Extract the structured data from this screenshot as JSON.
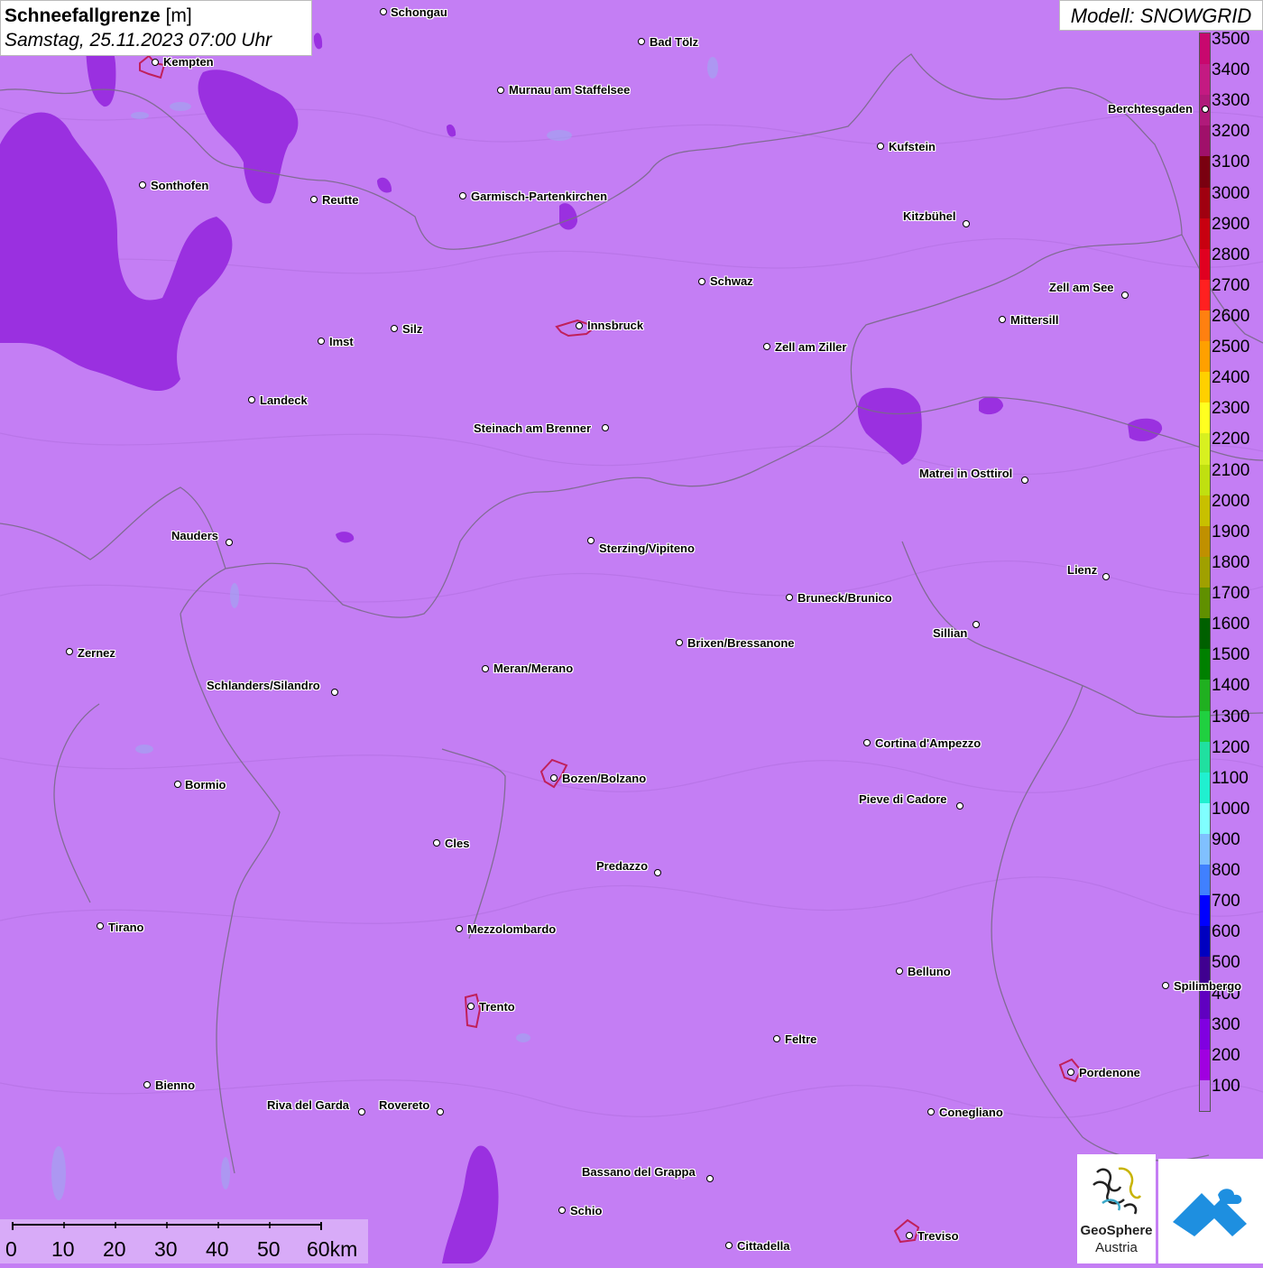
{
  "header": {
    "title_bold": "Schneefallgrenze",
    "title_unit": "[m]",
    "datetime": "Samstag, 25.11.2023 07:00 Uhr"
  },
  "model": {
    "label": "Modell: SNOWGRID"
  },
  "legend": {
    "levels": [
      3500,
      3400,
      3300,
      3200,
      3100,
      3000,
      2900,
      2800,
      2700,
      2600,
      2500,
      2400,
      2300,
      2200,
      2100,
      2000,
      1900,
      1800,
      1700,
      1600,
      1500,
      1400,
      1300,
      1200,
      1100,
      1000,
      900,
      800,
      700,
      600,
      500,
      400,
      300,
      200,
      100
    ],
    "colors": [
      "#c8086e",
      "#c41a82",
      "#b01a7a",
      "#a0106a",
      "#7a0010",
      "#a00010",
      "#c80010",
      "#e00020",
      "#ff2020",
      "#ff8010",
      "#ffa000",
      "#ffd000",
      "#ffff20",
      "#d8f020",
      "#c0e010",
      "#c8c000",
      "#c09000",
      "#a0a000",
      "#609000",
      "#006000",
      "#008000",
      "#20b020",
      "#20d040",
      "#20e0a0",
      "#20f0d0",
      "#80ffff",
      "#80c0ff",
      "#4080ff",
      "#0000ff",
      "#0000c0",
      "#400090",
      "#6000c0",
      "#8000e0",
      "#a000e0",
      "#c070f0"
    ]
  },
  "cities": [
    {
      "name": "Schongau",
      "dot": [
        425,
        13
      ],
      "label": [
        433,
        7
      ],
      "side": "r"
    },
    {
      "name": "Bad Tölz",
      "dot": [
        711,
        46
      ],
      "label": [
        720,
        40
      ],
      "side": "r"
    },
    {
      "name": "Kempten",
      "dot": [
        172,
        69
      ],
      "label": [
        181,
        62
      ],
      "side": "r"
    },
    {
      "name": "Murnau am Staffelsee",
      "dot": [
        555,
        100
      ],
      "label": [
        564,
        93
      ],
      "side": "r"
    },
    {
      "name": "Berchtesgaden",
      "dot": [
        1336,
        121
      ],
      "label": [
        1228,
        114
      ],
      "side": "l"
    },
    {
      "name": "Kufstein",
      "dot": [
        976,
        162
      ],
      "label": [
        985,
        156
      ],
      "side": "r"
    },
    {
      "name": "Sonthofen",
      "dot": [
        158,
        205
      ],
      "label": [
        167,
        199
      ],
      "side": "r"
    },
    {
      "name": "Reutte",
      "dot": [
        348,
        221
      ],
      "label": [
        357,
        215
      ],
      "side": "r"
    },
    {
      "name": "Garmisch-Partenkirchen",
      "dot": [
        513,
        217
      ],
      "label": [
        522,
        211
      ],
      "side": "r"
    },
    {
      "name": "Kitzbühel",
      "dot": [
        1071,
        248
      ],
      "label": [
        1001,
        233
      ],
      "side": "l"
    },
    {
      "name": "Schwaz",
      "dot": [
        778,
        312
      ],
      "label": [
        787,
        305
      ],
      "side": "r"
    },
    {
      "name": "Zell am See",
      "dot": [
        1247,
        327
      ],
      "label": [
        1163,
        312
      ],
      "side": "l"
    },
    {
      "name": "Mittersill",
      "dot": [
        1111,
        354
      ],
      "label": [
        1120,
        348
      ],
      "side": "r"
    },
    {
      "name": "Innsbruck",
      "dot": [
        642,
        361
      ],
      "label": [
        651,
        354
      ],
      "side": "r"
    },
    {
      "name": "Silz",
      "dot": [
        437,
        364
      ],
      "label": [
        446,
        358
      ],
      "side": "r"
    },
    {
      "name": "Imst",
      "dot": [
        356,
        378
      ],
      "label": [
        365,
        372
      ],
      "side": "r"
    },
    {
      "name": "Zell am Ziller",
      "dot": [
        850,
        384
      ],
      "label": [
        859,
        378
      ],
      "side": "r"
    },
    {
      "name": "Landeck",
      "dot": [
        279,
        443
      ],
      "label": [
        288,
        437
      ],
      "side": "r"
    },
    {
      "name": "Steinach am Brenner",
      "dot": [
        671,
        474
      ],
      "label": [
        525,
        468
      ],
      "side": "l"
    },
    {
      "name": "Matrei in Osttirol",
      "dot": [
        1136,
        532
      ],
      "label": [
        1019,
        518
      ],
      "side": "l"
    },
    {
      "name": "Nauders",
      "dot": [
        254,
        601
      ],
      "label": [
        190,
        587
      ],
      "side": "l"
    },
    {
      "name": "Sterzing/Vipiteno",
      "dot": [
        655,
        599
      ],
      "label": [
        664,
        601
      ],
      "side": "r"
    },
    {
      "name": "Lienz",
      "dot": [
        1226,
        639
      ],
      "label": [
        1183,
        625
      ],
      "side": "l"
    },
    {
      "name": "Bruneck/Brunico",
      "dot": [
        875,
        662
      ],
      "label": [
        884,
        656
      ],
      "side": "r"
    },
    {
      "name": "Sillian",
      "dot": [
        1082,
        692
      ],
      "label": [
        1034,
        695
      ],
      "side": "l"
    },
    {
      "name": "Brixen/Bressanone",
      "dot": [
        753,
        712
      ],
      "label": [
        762,
        706
      ],
      "side": "r"
    },
    {
      "name": "Zernez",
      "dot": [
        77,
        722
      ],
      "label": [
        86,
        717
      ],
      "side": "r"
    },
    {
      "name": "Meran/Merano",
      "dot": [
        538,
        741
      ],
      "label": [
        547,
        734
      ],
      "side": "r"
    },
    {
      "name": "Schlanders/Silandro",
      "dot": [
        371,
        767
      ],
      "label": [
        229,
        753
      ],
      "side": "l"
    },
    {
      "name": "Cortina d'Ampezzo",
      "dot": [
        961,
        823
      ],
      "label": [
        970,
        817
      ],
      "side": "r"
    },
    {
      "name": "Bozen/Bolzano",
      "dot": [
        614,
        862
      ],
      "label": [
        623,
        856
      ],
      "side": "r"
    },
    {
      "name": "Bormio",
      "dot": [
        197,
        869
      ],
      "label": [
        205,
        863
      ],
      "side": "r"
    },
    {
      "name": "Pieve di Cadore",
      "dot": [
        1064,
        893
      ],
      "label": [
        952,
        879
      ],
      "side": "l"
    },
    {
      "name": "Cles",
      "dot": [
        484,
        934
      ],
      "label": [
        493,
        928
      ],
      "side": "r"
    },
    {
      "name": "Predazzo",
      "dot": [
        729,
        967
      ],
      "label": [
        661,
        953
      ],
      "side": "l"
    },
    {
      "name": "Tirano",
      "dot": [
        111,
        1026
      ],
      "label": [
        120,
        1021
      ],
      "side": "r"
    },
    {
      "name": "Mezzolombardo",
      "dot": [
        509,
        1029
      ],
      "label": [
        518,
        1023
      ],
      "side": "r"
    },
    {
      "name": "Belluno",
      "dot": [
        997,
        1076
      ],
      "label": [
        1006,
        1070
      ],
      "side": "r"
    },
    {
      "name": "Spilimbergo",
      "dot": [
        1292,
        1092
      ],
      "label": [
        1301,
        1086
      ],
      "side": "r"
    },
    {
      "name": "Trento",
      "dot": [
        522,
        1115
      ],
      "label": [
        531,
        1109
      ],
      "side": "r"
    },
    {
      "name": "Feltre",
      "dot": [
        861,
        1151
      ],
      "label": [
        870,
        1145
      ],
      "side": "r"
    },
    {
      "name": "Pordenone",
      "dot": [
        1187,
        1188
      ],
      "label": [
        1196,
        1182
      ],
      "side": "r"
    },
    {
      "name": "Bienno",
      "dot": [
        163,
        1202
      ],
      "label": [
        172,
        1196
      ],
      "side": "r"
    },
    {
      "name": "Riva del Garda",
      "dot": [
        401,
        1232
      ],
      "label": [
        296,
        1218
      ],
      "side": "l"
    },
    {
      "name": "Rovereto",
      "dot": [
        488,
        1232
      ],
      "label": [
        420,
        1218
      ],
      "side": "l"
    },
    {
      "name": "Conegliano",
      "dot": [
        1032,
        1232
      ],
      "label": [
        1041,
        1226
      ],
      "side": "r"
    },
    {
      "name": "Bassano del Grappa",
      "dot": [
        787,
        1306
      ],
      "label": [
        645,
        1292
      ],
      "side": "l"
    },
    {
      "name": "Schio",
      "dot": [
        623,
        1341
      ],
      "label": [
        632,
        1335
      ],
      "side": "r"
    },
    {
      "name": "Treviso",
      "dot": [
        1008,
        1369
      ],
      "label": [
        1017,
        1363
      ],
      "side": "r"
    },
    {
      "name": "Cittadella",
      "dot": [
        808,
        1380
      ],
      "label": [
        817,
        1374
      ],
      "side": "r"
    }
  ],
  "scalebar": {
    "ticks": [
      "0",
      "10",
      "20",
      "30",
      "40",
      "50",
      "60km"
    ]
  },
  "logo": {
    "line1": "GeoSphere",
    "line2": "Austria"
  }
}
